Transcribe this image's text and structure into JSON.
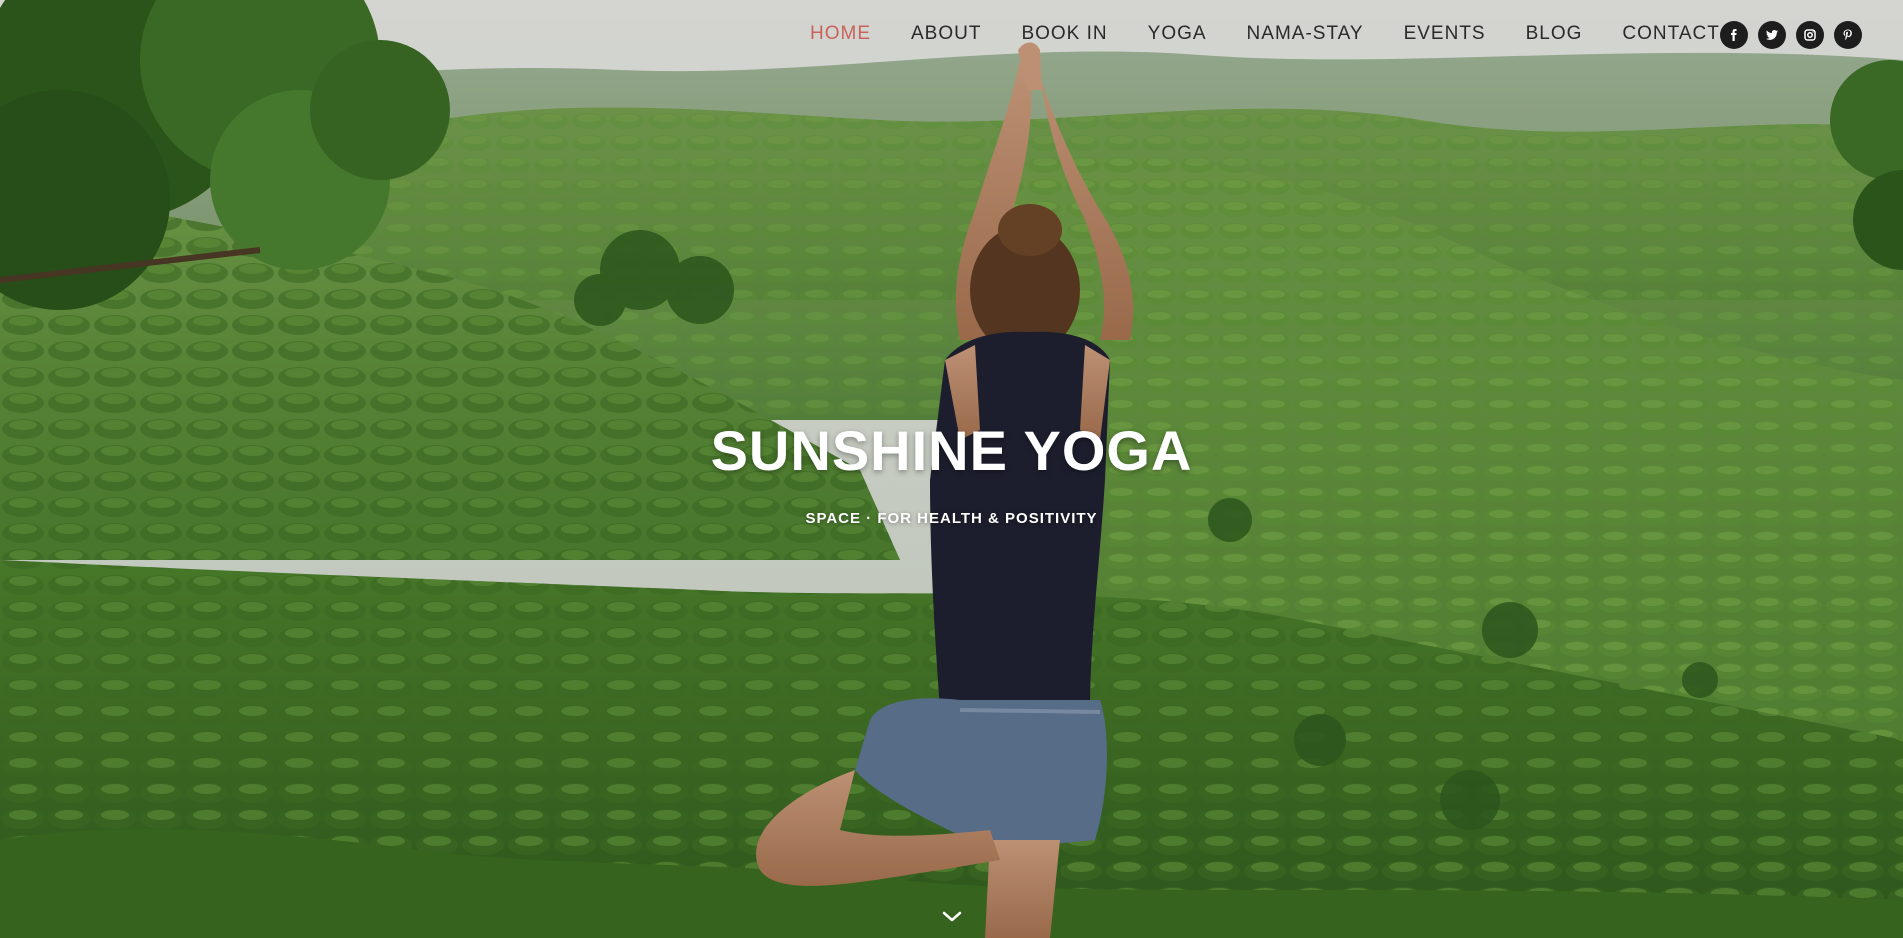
{
  "nav": {
    "items": [
      {
        "label": "HOME",
        "active": true
      },
      {
        "label": "ABOUT",
        "active": false
      },
      {
        "label": "BOOK IN",
        "active": false
      },
      {
        "label": "YOGA",
        "active": false
      },
      {
        "label": "NAMA-STAY",
        "active": false
      },
      {
        "label": "EVENTS",
        "active": false
      },
      {
        "label": "BLOG",
        "active": false
      },
      {
        "label": "CONTACT",
        "active": false
      }
    ],
    "active_color": "#c9625b",
    "social": [
      {
        "icon": "facebook-icon"
      },
      {
        "icon": "twitter-icon"
      },
      {
        "icon": "instagram-icon"
      },
      {
        "icon": "pinterest-icon"
      }
    ]
  },
  "hero": {
    "title": "SUNSHINE YOGA",
    "subtitle": "SPACE · FOR HEALTH & POSITIVITY",
    "scroll_icon": "chevron-down-icon"
  }
}
